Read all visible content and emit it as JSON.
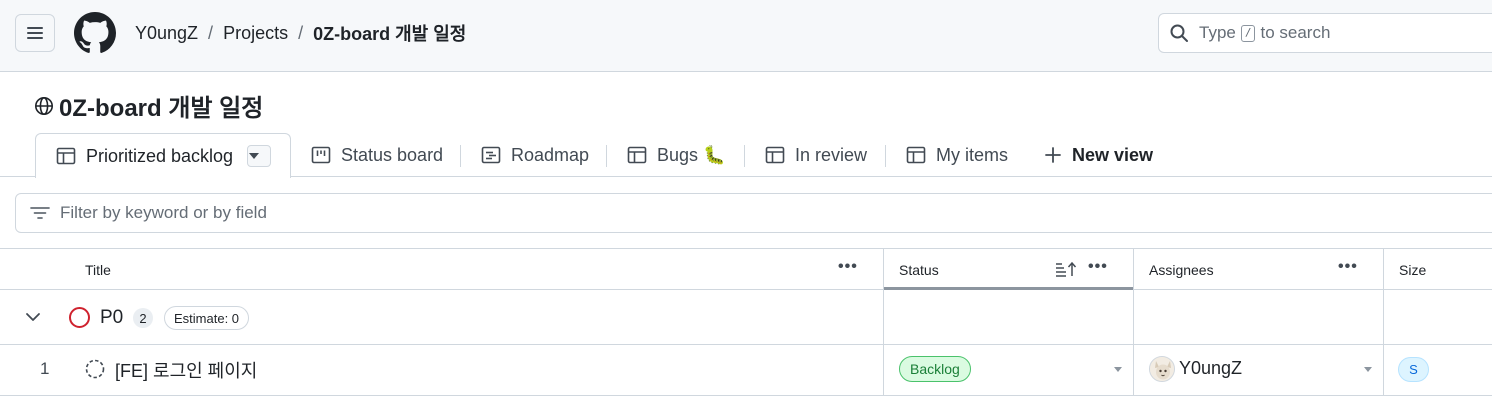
{
  "header": {
    "breadcrumb": {
      "owner": "Y0ungZ",
      "projects": "Projects",
      "current": "0Z-board 개발 일정",
      "separator": "/"
    },
    "search": {
      "prefix": "Type",
      "key": "/",
      "suffix": "to search"
    }
  },
  "project": {
    "title": "0Z-board 개발 일정",
    "visibility_icon": "globe-icon"
  },
  "tabs": [
    {
      "label": "Prioritized backlog",
      "icon": "table-icon",
      "active": true
    },
    {
      "label": "Status board",
      "icon": "board-icon"
    },
    {
      "label": "Roadmap",
      "icon": "roadmap-icon"
    },
    {
      "label": "Bugs 🐛",
      "icon": "table-icon"
    },
    {
      "label": "In review",
      "icon": "table-icon"
    },
    {
      "label": "My items",
      "icon": "table-icon"
    }
  ],
  "new_view": {
    "label": "New view"
  },
  "filter": {
    "placeholder": "Filter by keyword or by field"
  },
  "table": {
    "columns": [
      "Title",
      "Status",
      "Assignees",
      "Size"
    ],
    "group": {
      "label": "P0",
      "count": "2",
      "estimate": "Estimate: 0",
      "color": "#cf222e"
    },
    "rows": [
      {
        "num": "1",
        "title": "[FE] 로그인 페이지",
        "status": "Backlog",
        "assignee": "Y0ungZ",
        "size": "S"
      }
    ]
  },
  "colors": {
    "border": "#d0d7de",
    "status_backlog_bg": "#dafbe1",
    "status_backlog_fg": "#1a7f37",
    "size_bg": "#ddf4ff",
    "size_fg": "#0969da"
  }
}
